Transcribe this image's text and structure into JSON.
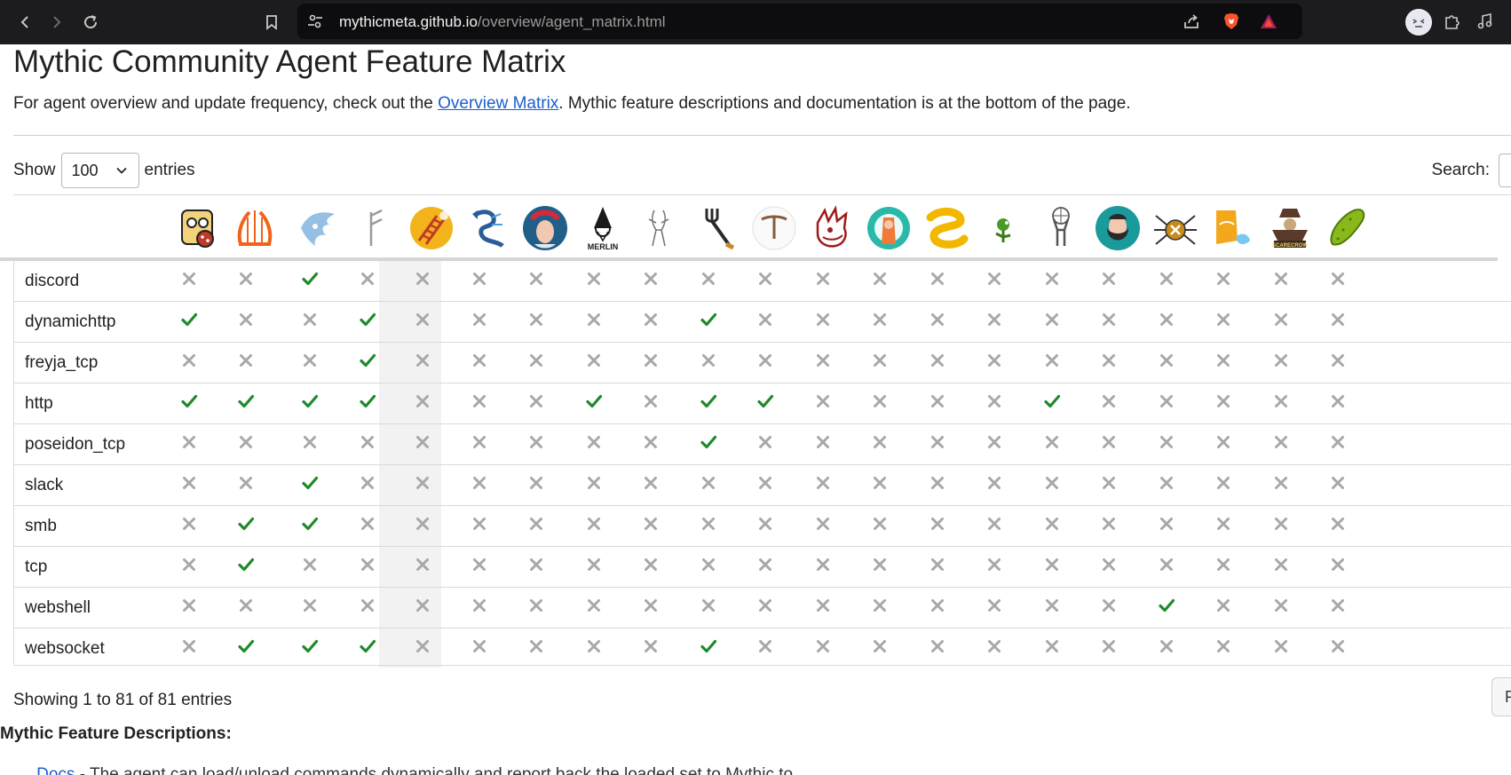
{
  "browser": {
    "url_host": "mythicmeta.github.io",
    "url_path": "/overview/agent_matrix.html"
  },
  "page": {
    "title": "Mythic Community Agent Feature Matrix",
    "intro_before": "For agent overview and update frequency, check out the ",
    "intro_link": "Overview Matrix",
    "intro_after": ". Mythic feature descriptions and documentation is at the bottom of the page.",
    "show_label": "Show",
    "entries_value": "100",
    "entries_label": "entries",
    "search_label": "Search:",
    "info": "Showing 1 to 81 of 81 entries",
    "paginate_partial": "P",
    "descriptions_heading": "Mythic Feature Descriptions:",
    "desc_bold": "...",
    "desc_link": "Docs",
    "desc_text": " - The agent can load/unload commands dynamically and report back the loaded set to Mythic to ..."
  },
  "colors": {
    "check": "#1e8a2b",
    "cross": "#a8a8a8",
    "link": "#1a5fd0"
  },
  "agents": [
    {
      "icon": "robot-icon",
      "color": "#6a4a2a"
    },
    {
      "icon": "lyre-icon",
      "color": "#f06418"
    },
    {
      "icon": "blue-wing-icon",
      "color": "#8ab8e0"
    },
    {
      "icon": "rune-icon",
      "color": "#9a9a9a"
    },
    {
      "icon": "ladder-icon",
      "color": "#f2b41a"
    },
    {
      "icon": "sea-dragon-icon",
      "color": "#2a5c9a"
    },
    {
      "icon": "medusa-icon",
      "color": "#1f5f8a"
    },
    {
      "icon": "merlin-icon",
      "color": "#1a1a1a"
    },
    {
      "icon": "sketch-figure-icon",
      "color": "#777777"
    },
    {
      "icon": "trident-icon",
      "color": "#2a2a2a"
    },
    {
      "icon": "t-shape-icon",
      "color": "#8a5a3a"
    },
    {
      "icon": "red-dragon-icon",
      "color": "#a01a1a"
    },
    {
      "icon": "teal-gear-icon",
      "color": "#2ab8a8"
    },
    {
      "icon": "yellow-swirl-icon",
      "color": "#f2b800"
    },
    {
      "icon": "plant-icon",
      "color": "#4a9a2a"
    },
    {
      "icon": "atlas-icon",
      "color": "#555555"
    },
    {
      "icon": "bearded-face-icon",
      "color": "#1a9a9a"
    },
    {
      "icon": "spider-icon",
      "color": "#c88a1a"
    },
    {
      "icon": "candy-icon",
      "color": "#f2a81a"
    },
    {
      "icon": "scarecrow-icon",
      "color": "#5a3a2a"
    },
    {
      "icon": "pickle-icon",
      "color": "#8ab81a"
    }
  ],
  "rows": [
    {
      "label": "discord",
      "values": [
        0,
        0,
        1,
        0,
        0,
        0,
        0,
        0,
        0,
        0,
        0,
        0,
        0,
        0,
        0,
        0,
        0,
        0,
        0,
        0,
        0
      ]
    },
    {
      "label": "dynamichttp",
      "values": [
        1,
        0,
        0,
        1,
        0,
        0,
        0,
        0,
        0,
        1,
        0,
        0,
        0,
        0,
        0,
        0,
        0,
        0,
        0,
        0,
        0
      ]
    },
    {
      "label": "freyja_tcp",
      "values": [
        0,
        0,
        0,
        1,
        0,
        0,
        0,
        0,
        0,
        0,
        0,
        0,
        0,
        0,
        0,
        0,
        0,
        0,
        0,
        0,
        0
      ]
    },
    {
      "label": "http",
      "values": [
        1,
        1,
        1,
        1,
        0,
        0,
        0,
        1,
        0,
        1,
        1,
        0,
        0,
        0,
        0,
        1,
        0,
        0,
        0,
        0,
        0
      ]
    },
    {
      "label": "poseidon_tcp",
      "values": [
        0,
        0,
        0,
        0,
        0,
        0,
        0,
        0,
        0,
        1,
        0,
        0,
        0,
        0,
        0,
        0,
        0,
        0,
        0,
        0,
        0
      ]
    },
    {
      "label": "slack",
      "values": [
        0,
        0,
        1,
        0,
        0,
        0,
        0,
        0,
        0,
        0,
        0,
        0,
        0,
        0,
        0,
        0,
        0,
        0,
        0,
        0,
        0
      ]
    },
    {
      "label": "smb",
      "values": [
        0,
        1,
        1,
        0,
        0,
        0,
        0,
        0,
        0,
        0,
        0,
        0,
        0,
        0,
        0,
        0,
        0,
        0,
        0,
        0,
        0
      ]
    },
    {
      "label": "tcp",
      "values": [
        0,
        1,
        0,
        0,
        0,
        0,
        0,
        0,
        0,
        0,
        0,
        0,
        0,
        0,
        0,
        0,
        0,
        0,
        0,
        0,
        0
      ]
    },
    {
      "label": "webshell",
      "values": [
        0,
        0,
        0,
        0,
        0,
        0,
        0,
        0,
        0,
        0,
        0,
        0,
        0,
        0,
        0,
        0,
        0,
        1,
        0,
        0,
        0
      ]
    },
    {
      "label": "websocket",
      "values": [
        0,
        1,
        1,
        1,
        0,
        0,
        0,
        0,
        0,
        1,
        0,
        0,
        0,
        0,
        0,
        0,
        0,
        0,
        0,
        0,
        0
      ]
    }
  ]
}
